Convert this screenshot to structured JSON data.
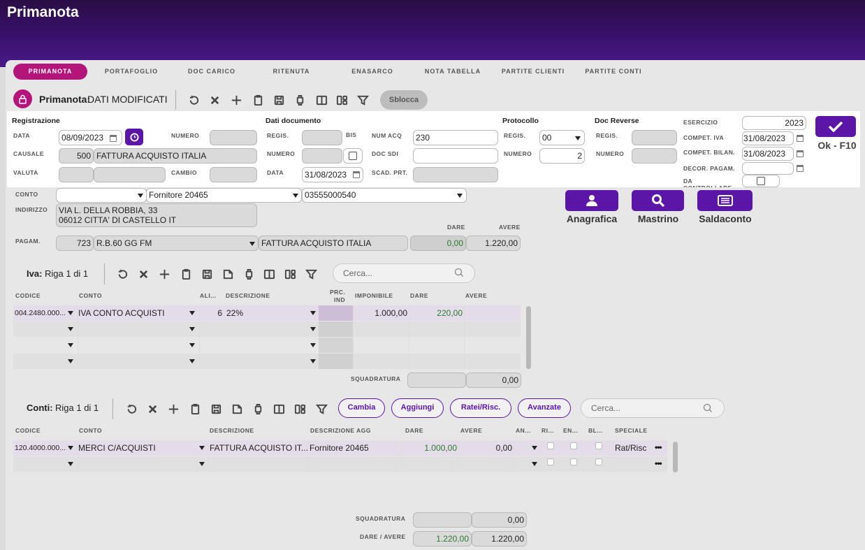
{
  "app": {
    "title": "Primanota"
  },
  "tabs": [
    {
      "label": "PRIMANOTA",
      "active": true
    },
    {
      "label": "PORTAFOGLIO"
    },
    {
      "label": "DOC CARICO"
    },
    {
      "label": "RITENUTA"
    },
    {
      "label": "ENASARCO"
    },
    {
      "label": "NOTA TABELLA"
    },
    {
      "label": "PARTITE CLIENTI"
    },
    {
      "label": "PARTITE CONTI"
    }
  ],
  "toolbar": {
    "title": "Primanota:",
    "status": "DATI MODIFICATI",
    "unlock_label": "Sblocca"
  },
  "registrazione": {
    "section": "Registrazione",
    "data_label": "DATA",
    "data_value": "08/09/2023",
    "numero_label": "NUMERO",
    "numero_value": "",
    "causale_label": "CAUSALE",
    "causale_code": "500",
    "causale_desc": "FATTURA ACQUISTO ITALIA",
    "valuta_label": "VALUTA",
    "cambio_label": "CAMBIO"
  },
  "dati_documento": {
    "section": "Dati documento",
    "regis_label": "REGIS.",
    "bis_label": "BIS",
    "numero_label": "NUMERO",
    "data_label": "DATA",
    "data_value": "31/08/2023",
    "num_acq_label": "NUM ACQ",
    "num_acq_value": "230",
    "doc_sdi_label": "DOC SDI",
    "scad_prt_label": "SCAD. PRT."
  },
  "protocollo": {
    "section": "Protocollo",
    "regis_label": "REGIS.",
    "regis_value": "00",
    "numero_label": "NUMERO",
    "numero_value": "2"
  },
  "doc_reverse": {
    "section": "Doc Reverse",
    "regis_label": "REGIS.",
    "numero_label": "NUMERO"
  },
  "esercizio": {
    "esercizio_label": "ESERCIZIO",
    "esercizio_value": "2023",
    "compet_iva_label": "COMPET. IVA",
    "compet_iva_value": "31/08/2023",
    "compet_bilan_label": "COMPET. BILAN.",
    "compet_bilan_value": "31/08/2023",
    "decor_pagam_label": "DECOR. PAGAM.",
    "da_controllare_label": "DA CONTROLLARE"
  },
  "ok_button": {
    "label": "Ok - F10"
  },
  "conto": {
    "conto_label": "CONTO",
    "conto_value": "Fornitore 20465",
    "piva_value": "03555000540",
    "indirizzo_label": "INDIRIZZO",
    "indirizzo_line1": "VIA L. DELLA ROBBIA, 33",
    "indirizzo_line2": "06012 CITTA' DI CASTELLO IT",
    "dare_label": "DARE",
    "avere_label": "AVERE",
    "pagam_label": "PAGAM.",
    "pagam_code": "723",
    "pagam_desc": "R.B.60 GG FM",
    "pagam_doc": "FATTURA ACQUISTO ITALIA",
    "dare_value": "0,00",
    "avere_value": "1.220,00"
  },
  "actions": {
    "anagrafica": "Anagrafica",
    "mastrino": "Mastrino",
    "saldaconto": "Saldaconto"
  },
  "iva": {
    "title": "Iva:",
    "riga": "Riga 1 di 1",
    "search_placeholder": "Cerca...",
    "headers": {
      "codice": "CODICE",
      "conto": "CONTO",
      "ali": "ALI...",
      "descrizione": "DESCRIZIONE",
      "prc1": "PRC.",
      "prc2": "IND",
      "imponibile": "IMPONIBILE",
      "dare": "DARE",
      "avere": "AVERE"
    },
    "rows": [
      {
        "codice": "004.2480.000...",
        "conto": "IVA CONTO ACQUISTI",
        "ali": "6",
        "descrizione": "22%",
        "imponibile": "1.000,00",
        "dare": "220,00",
        "avere": ""
      }
    ],
    "squadratura_label": "SQUADRATURA",
    "squadratura_value": "0,00"
  },
  "conti": {
    "title": "Conti:",
    "riga": "Riga 1 di 1",
    "search_placeholder": "Cerca...",
    "buttons": {
      "cambia": "Cambia",
      "aggiungi": "Aggiungi",
      "ratei": "Ratei/Risc.",
      "avanzate": "Avanzate"
    },
    "headers": {
      "codice": "CODICE",
      "conto": "CONTO",
      "descrizione": "DESCRIZIONE",
      "descrizione_agg": "DESCRIZIONE AGG",
      "dare": "DARE",
      "avere": "AVERE",
      "an": "AN...",
      "ri": "RI...",
      "en": "EN...",
      "bl": "BL...",
      "speciale": "SPECIALE"
    },
    "rows": [
      {
        "codice": "120.4000.000...",
        "conto": "MERCI C/ACQUISTI",
        "descrizione": "FATTURA ACQUISTO IT...",
        "descrizione_agg": "Fornitore 20465",
        "dare": "1.000,00",
        "avere": "0,00",
        "speciale": "Rat/Risc"
      }
    ],
    "squadratura_label": "SQUADRATURA",
    "squadratura_value": "0,00",
    "dare_avere_label": "DARE / AVERE",
    "dare_total": "1.220,00",
    "avere_total": "1.220,00"
  },
  "colors": {
    "accent": "#5b16a8",
    "tab_active": "#b3157a",
    "header_bg": "#3b1170",
    "row_highlight": "#e5dcea"
  }
}
